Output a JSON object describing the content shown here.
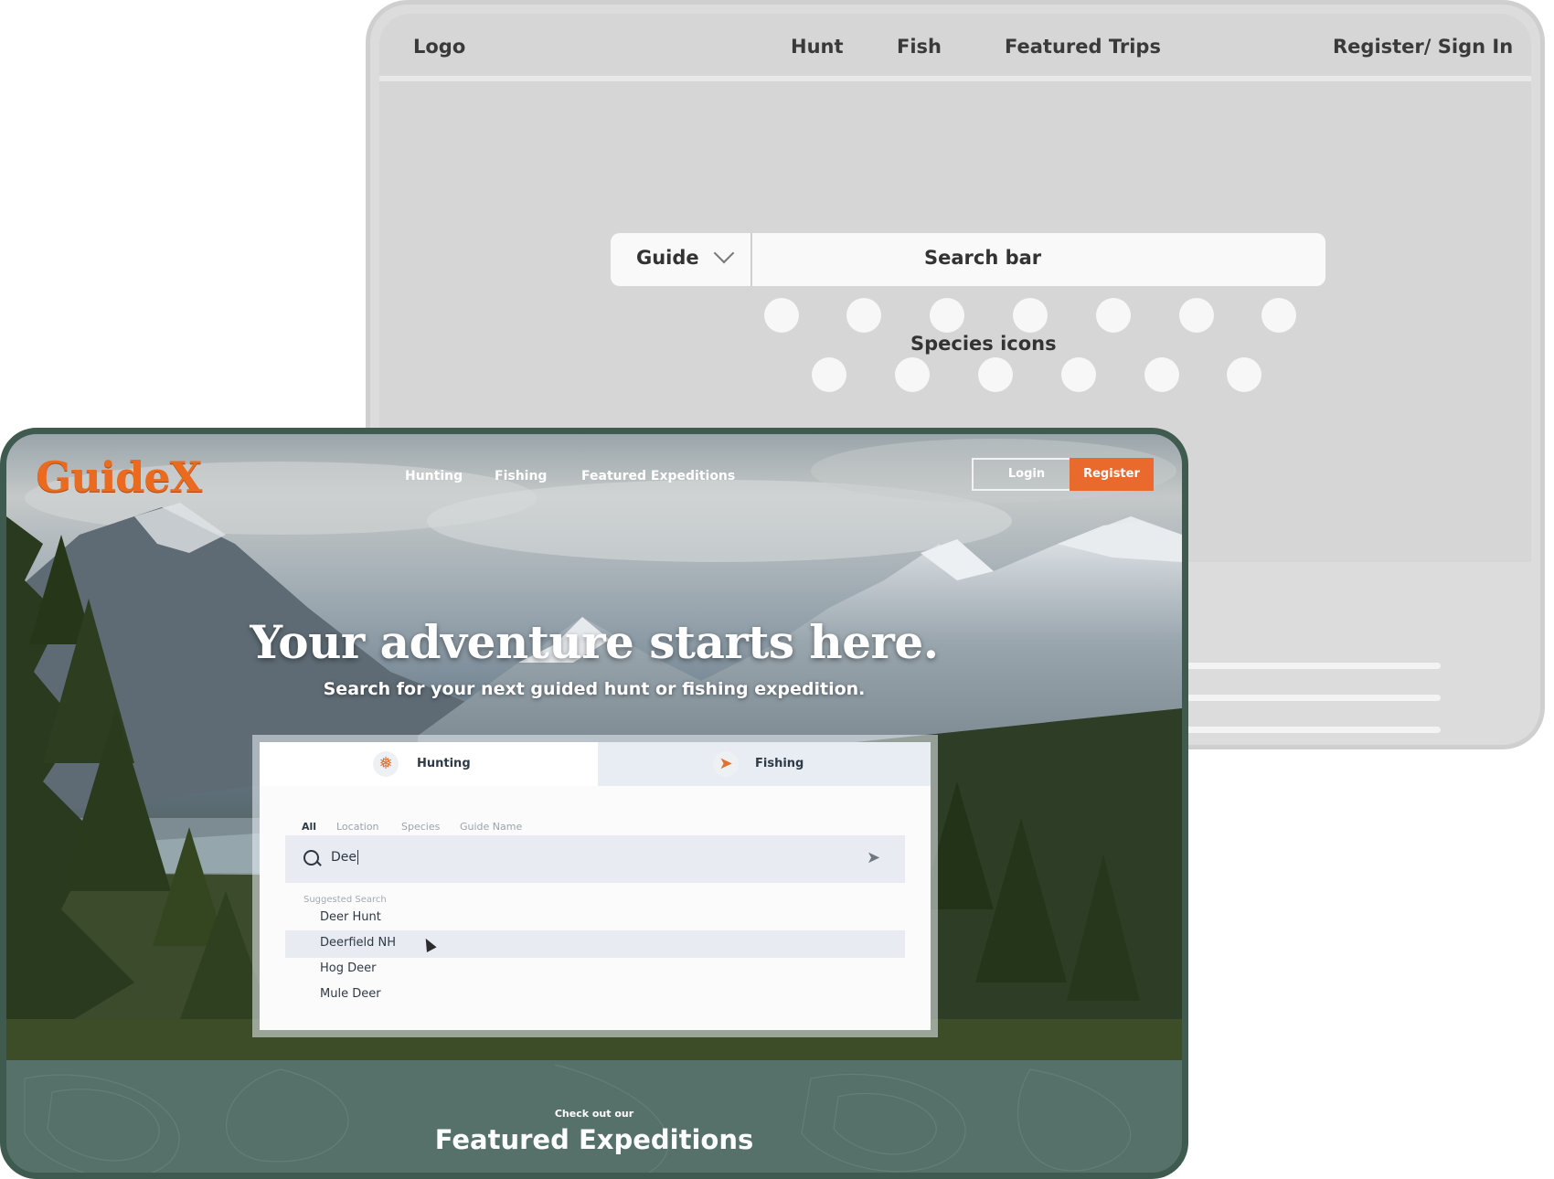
{
  "wireframe": {
    "nav": {
      "logo": "Logo",
      "hunt": "Hunt",
      "fish": "Fish",
      "featured": "Featured Trips",
      "auth": "Register/ Sign In"
    },
    "search": {
      "dropdown_value": "Guide",
      "bar_label": "Search bar"
    },
    "species_label": "Species icons"
  },
  "mock": {
    "logo": "GuideX",
    "nav": {
      "hunting": "Hunting",
      "fishing": "Fishing",
      "featured": "Featured Expeditions"
    },
    "login": "Login",
    "register": "Register",
    "headline": "Your adventure starts here.",
    "subline": "Search for your next guided hunt or fishing expedition.",
    "tabs": {
      "hunting": "Hunting",
      "fishing": "Fishing",
      "active": "Hunting"
    },
    "filters": [
      "All",
      "Location",
      "Species",
      "Guide Name"
    ],
    "active_filter": "All",
    "search_value": "Dee",
    "suggested_label": "Suggested Search",
    "suggestions": [
      "Deer Hunt",
      "Deerfield NH",
      "Hog Deer",
      "Mule Deer"
    ],
    "highlighted_suggestion": "Deerfield NH",
    "featured_kicker": "Check out our",
    "featured_title": "Featured Expeditions"
  },
  "colors": {
    "brand_orange": "#ea6a1f",
    "forest_green": "#55716a",
    "wireframe_gray": "#dcdcdc"
  },
  "icons": {
    "hunting_tab": "deer-icon",
    "fishing_tab": "fish-icon",
    "search": "search-icon",
    "send": "send-arrow-icon"
  }
}
